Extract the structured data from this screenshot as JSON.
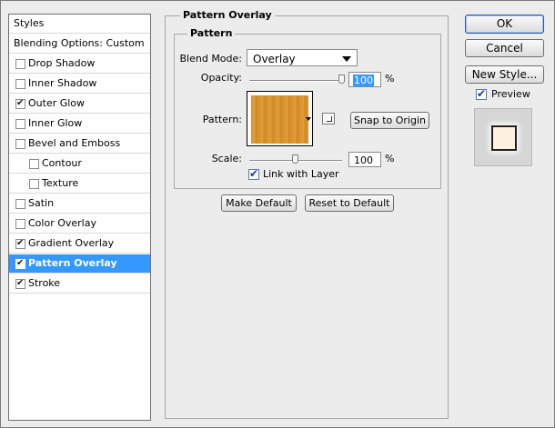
{
  "styles_panel": {
    "header": "Styles",
    "items": [
      {
        "label": "Blending Options: Custom",
        "has_checkbox": false,
        "checked": false,
        "sub": false,
        "selected": false
      },
      {
        "label": "Drop Shadow",
        "has_checkbox": true,
        "checked": false,
        "sub": false,
        "selected": false
      },
      {
        "label": "Inner Shadow",
        "has_checkbox": true,
        "checked": false,
        "sub": false,
        "selected": false
      },
      {
        "label": "Outer Glow",
        "has_checkbox": true,
        "checked": true,
        "sub": false,
        "selected": false
      },
      {
        "label": "Inner Glow",
        "has_checkbox": true,
        "checked": false,
        "sub": false,
        "selected": false
      },
      {
        "label": "Bevel and Emboss",
        "has_checkbox": true,
        "checked": false,
        "sub": false,
        "selected": false
      },
      {
        "label": "Contour",
        "has_checkbox": true,
        "checked": false,
        "sub": true,
        "selected": false
      },
      {
        "label": "Texture",
        "has_checkbox": true,
        "checked": false,
        "sub": true,
        "selected": false
      },
      {
        "label": "Satin",
        "has_checkbox": true,
        "checked": false,
        "sub": false,
        "selected": false
      },
      {
        "label": "Color Overlay",
        "has_checkbox": true,
        "checked": false,
        "sub": false,
        "selected": false
      },
      {
        "label": "Gradient Overlay",
        "has_checkbox": true,
        "checked": true,
        "sub": false,
        "selected": false
      },
      {
        "label": "Pattern Overlay",
        "has_checkbox": true,
        "checked": true,
        "sub": false,
        "selected": true
      },
      {
        "label": "Stroke",
        "has_checkbox": true,
        "checked": true,
        "sub": false,
        "selected": false
      }
    ]
  },
  "pattern_overlay": {
    "group_title": "Pattern Overlay",
    "sub_group_title": "Pattern",
    "blend_mode_label": "Blend Mode:",
    "blend_mode_value": "Overlay",
    "opacity_label": "Opacity:",
    "opacity_value": "100",
    "opacity_fraction": 1.0,
    "percent_sign": "%",
    "pattern_label": "Pattern:",
    "pattern_color": "#d7922a",
    "snap_button": "Snap to Origin",
    "scale_label": "Scale:",
    "scale_value": "100",
    "scale_fraction": 0.5,
    "link_with_layer_label": "Link with Layer",
    "link_with_layer_checked": true,
    "make_default_button": "Make Default",
    "reset_default_button": "Reset to Default"
  },
  "actions": {
    "ok": "OK",
    "cancel": "Cancel",
    "new_style": "New Style...",
    "preview_label": "Preview",
    "preview_checked": true
  },
  "colors": {
    "selection": "#3399ff",
    "dialog_bg": "#ececec"
  }
}
